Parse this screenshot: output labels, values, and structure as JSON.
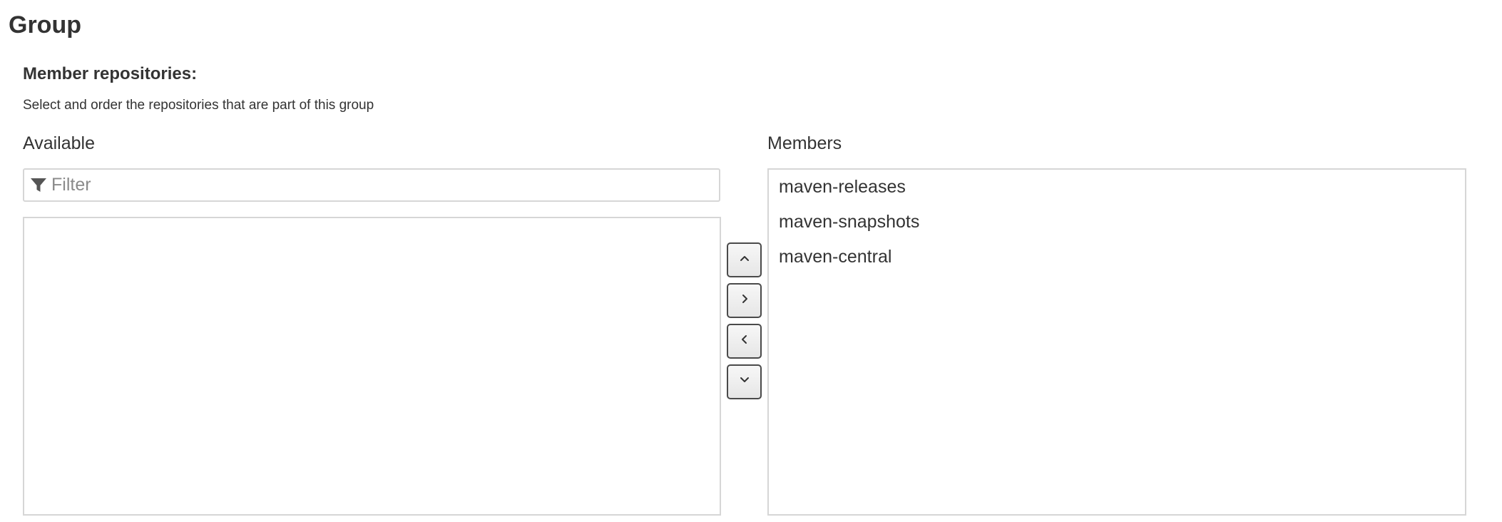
{
  "page": {
    "title": "Group"
  },
  "section": {
    "title": "Member repositories:",
    "description": "Select and order the repositories that are part of this group"
  },
  "available": {
    "label": "Available",
    "filter": {
      "placeholder": "Filter",
      "value": "",
      "icon": "filter-icon"
    },
    "items": []
  },
  "members": {
    "label": "Members",
    "items": [
      "maven-releases",
      "maven-snapshots",
      "maven-central"
    ]
  },
  "controls": {
    "move_up_icon": "chevron-up-icon",
    "add_icon": "chevron-right-icon",
    "remove_icon": "chevron-left-icon",
    "move_down_icon": "chevron-down-icon"
  },
  "colors": {
    "text": "#333333",
    "border": "#d6d6d6",
    "button_border": "#4a4a4a",
    "placeholder": "#8a8a8a"
  }
}
